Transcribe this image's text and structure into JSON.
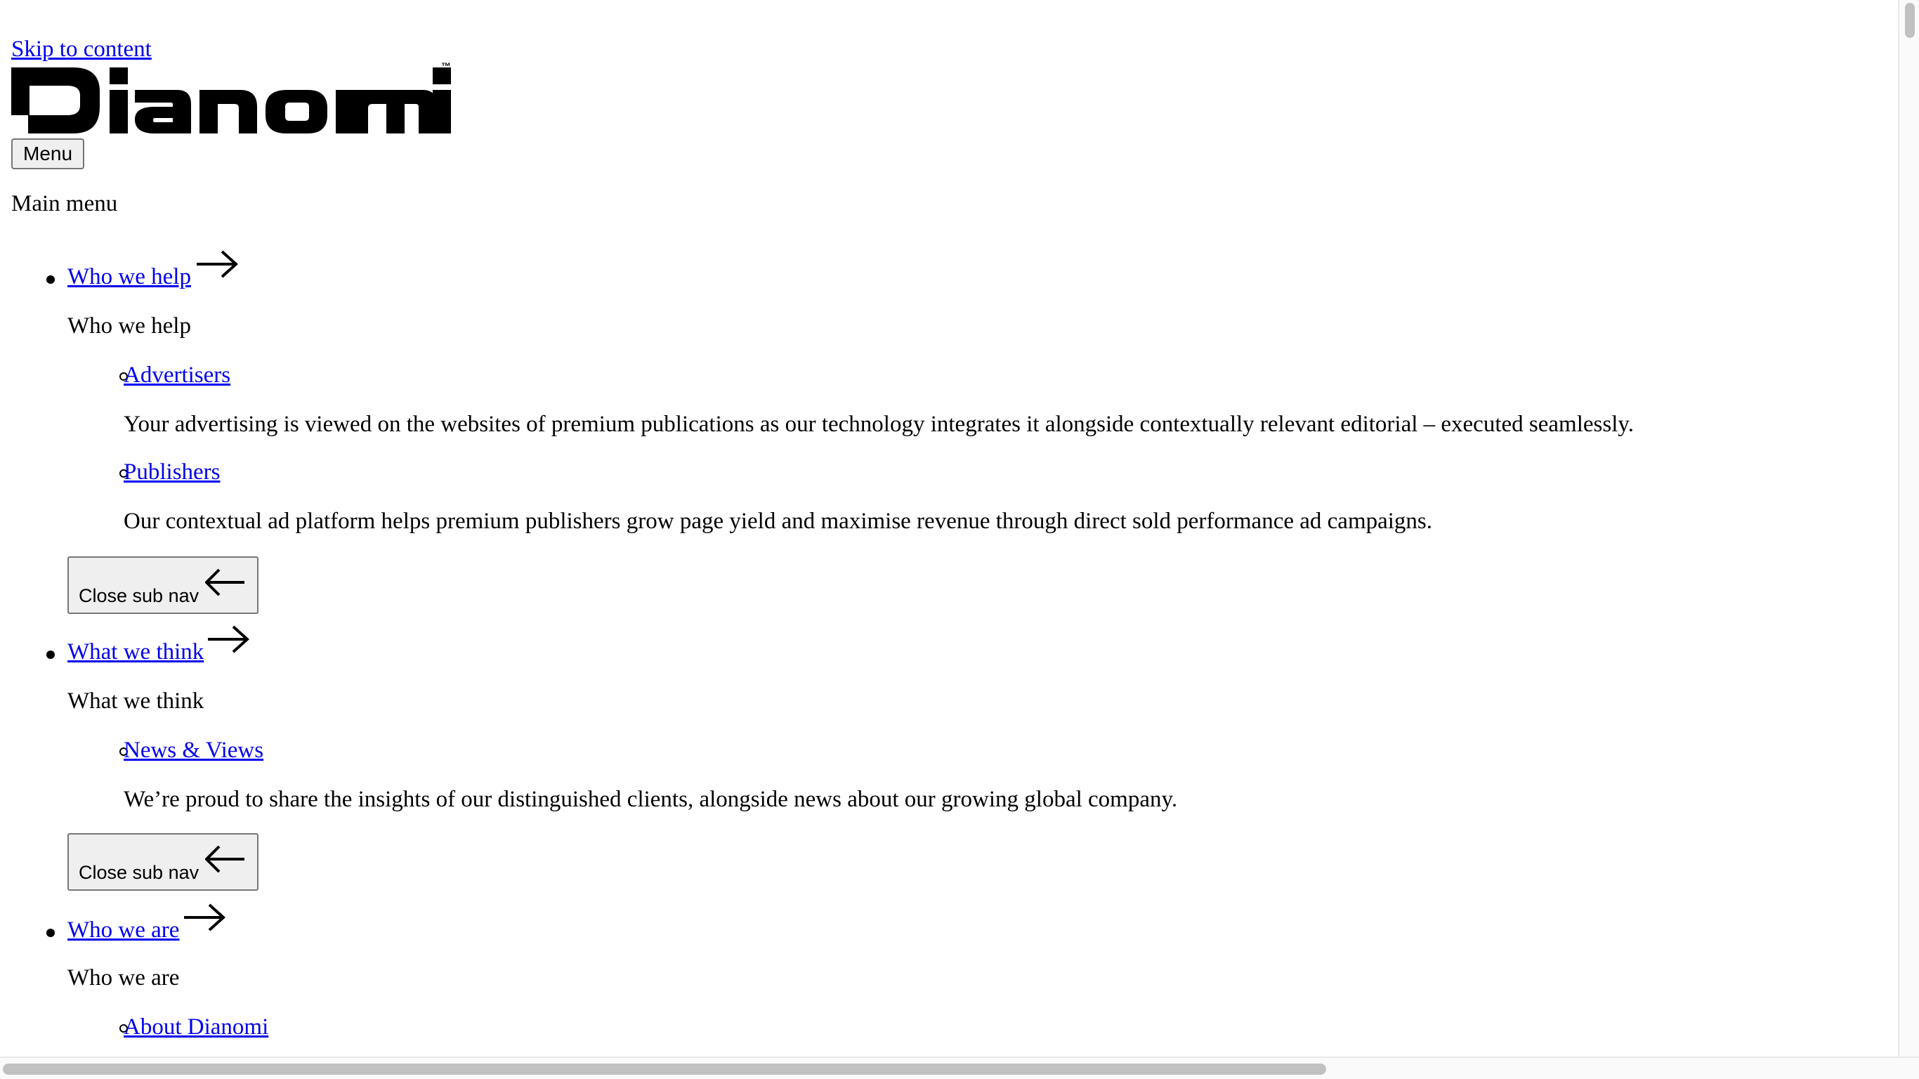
{
  "skip_link": "Skip to content",
  "logo": {
    "text": "Dianomi",
    "trademark": "™"
  },
  "menu_button": "Menu",
  "main_menu_title": "Main menu",
  "nav": {
    "sections": [
      {
        "link": "Who we help ",
        "heading": "Who we help",
        "items": [
          {
            "label": "Advertisers",
            "description": "Your advertising is viewed on the websites of premium publications as our technology integrates it alongside contextually relevant editorial – executed seamlessly."
          },
          {
            "label": "Publishers",
            "description": "Our contextual ad platform helps premium publishers grow page yield and maximise revenue through direct sold performance ad campaigns."
          }
        ],
        "close_label": "Close sub nav"
      },
      {
        "link": "What we think ",
        "heading": "What we think",
        "items": [
          {
            "label": "News & Views",
            "description": "We’re proud to share the insights of our distinguished clients, alongside news about our growing global company."
          }
        ],
        "close_label": "Close sub nav"
      },
      {
        "link": "Who we are ",
        "heading": "Who we are",
        "items": [
          {
            "label": "About Dianomi"
          }
        ]
      }
    ]
  },
  "icons": {
    "open_submenu": "arrow-right-icon",
    "close_submenu": "arrow-left-icon"
  },
  "colors": {
    "link": "#0000ee",
    "text": "#000000",
    "button_bg": "#efefef",
    "button_border": "#767676"
  }
}
